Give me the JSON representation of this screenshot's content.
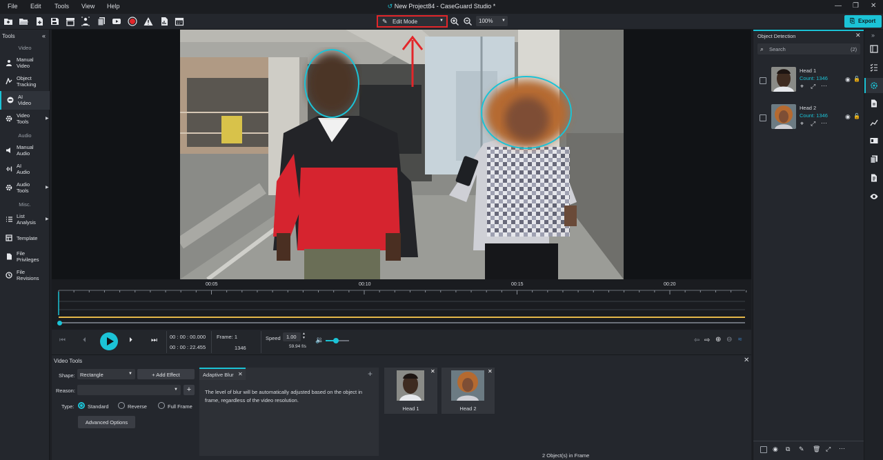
{
  "menu": [
    "File",
    "Edit",
    "Tools",
    "View",
    "Help"
  ],
  "window_title": "New Project84 - CaseGuard Studio *",
  "toolbar": {
    "mode_label": "Edit Mode",
    "zoom_value": "100%",
    "export_label": "Export"
  },
  "left_panel": {
    "title": "Tools",
    "sections": {
      "video": "Video",
      "audio": "Audio",
      "misc": "Misc."
    },
    "items": [
      {
        "label": "Manual\nVideo"
      },
      {
        "label": "Object\nTracking"
      },
      {
        "label": "AI\nVideo"
      },
      {
        "label": "Video\nTools"
      },
      {
        "label": "Manual\nAudio"
      },
      {
        "label": "AI\nAudio"
      },
      {
        "label": "Audio\nTools"
      },
      {
        "label": "List\nAnalysis"
      },
      {
        "label": "Template"
      },
      {
        "label": "File\nPrivileges"
      },
      {
        "label": "File\nRevisions"
      }
    ]
  },
  "timeline": {
    "markers": [
      "00:05",
      "00:10",
      "00:15",
      "00:20"
    ],
    "playhead_fraction": 0.0
  },
  "transport": {
    "current_time": "00 : 00 : 00.000",
    "total_time": "00 : 00 : 22.455",
    "frame_label": "Frame: 1",
    "frame_total": "1346",
    "speed_label": "Speed",
    "speed_value": "1.00",
    "fps": "59.94 f/s",
    "volume_fraction": 0.45
  },
  "video_tools": {
    "title": "Video Tools",
    "shape_label": "Shape:",
    "shape_value": "Rectangle",
    "add_effect_label": "+ Add Effect",
    "reason_label": "Reason:",
    "reason_value": "",
    "type_label": "Type:",
    "type_options": [
      "Standard",
      "Reverse",
      "Full Frame"
    ],
    "advanced_label": "Advanced Options",
    "effect_tab": "Adaptive Blur",
    "effect_description": "The level of blur will be automatically adjusted based on the object in frame, regardless of the video resolution.",
    "objects": [
      {
        "label": "Head 1"
      },
      {
        "label": "Head 2"
      }
    ],
    "status": "2 Object(s) in Frame"
  },
  "object_detection": {
    "title": "Object Detection",
    "search_placeholder": "Search",
    "search_count": "(2)",
    "items": [
      {
        "name": "Head 1",
        "count": "Count: 1346"
      },
      {
        "name": "Head 2",
        "count": "Count: 1346"
      }
    ]
  },
  "colors": {
    "accent": "#1bc3d6",
    "highlight": "#e3262a",
    "timeline_bar": "#e6b84a"
  }
}
